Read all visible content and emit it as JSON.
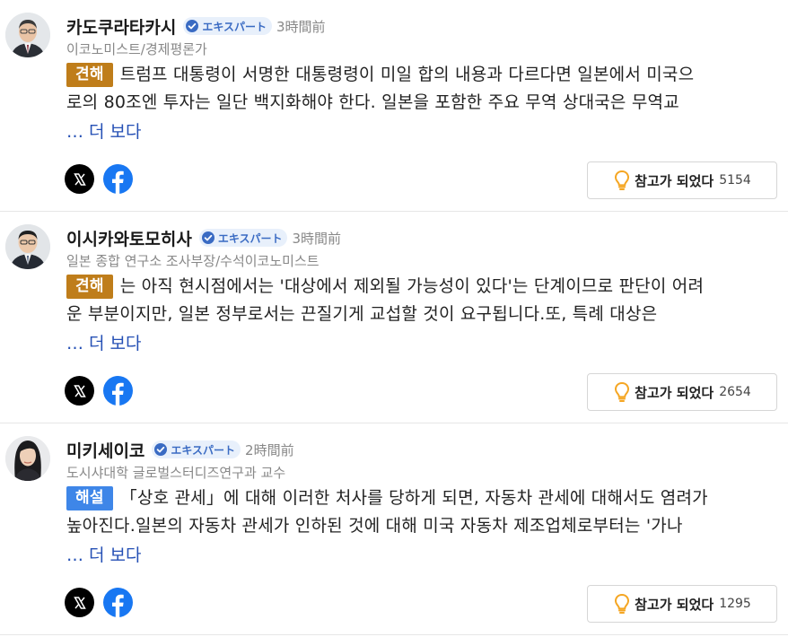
{
  "comments": [
    {
      "author": "카도쿠라타카시",
      "badge": "エキスパート",
      "time": "3時間前",
      "title": "이코노미스트/경제평론가",
      "label": "견해",
      "line1": "트럼프 대통령이 서명한 대통령령이 미일 합의 내용과 다르다면 일본에서 미국으",
      "line2": "로의 80조엔 투자는 일단 백지화해야 한다. 일본을 포함한 주요 무역 상대국은 무역교",
      "more": "… 더 보다",
      "helpful_label": "참고가 되었다",
      "helpful_count": "5154",
      "avatar": "man-in-suit-with-glasses"
    },
    {
      "author": "이시카와토모히사",
      "badge": "エキスパート",
      "time": "3時間前",
      "title": "일본 종합 연구소 조사부장/수석이코노미스트",
      "label": "견해",
      "line1": "는 아직 현시점에서는 '대상에서 제외될 가능성이 있다'는 단계이므로 판단이 어려",
      "line2": "운 부분이지만, 일본 정부로서는 끈질기게 교섭할 것이 요구됩니다.또, 특례 대상은",
      "more": "… 더 보다",
      "helpful_label": "참고가 되었다",
      "helpful_count": "2654",
      "avatar": "man-in-suit-with-glasses"
    },
    {
      "author": "미키세이코",
      "badge": "エキスパート",
      "time": "2時間前",
      "title": "도시샤대학 글로벌스터디즈연구과 교수",
      "label": "해설",
      "line1": "「상호 관세」에 대해 이러한 처사를 당하게 되면, 자동차 관세에 대해서도 염려가",
      "line2": "높아진다.일본의 자동차 관세가 인하된 것에 대해 미국 자동차 제조업체로부터는 '가나",
      "more": "… 더 보다",
      "helpful_label": "참고가 되었다",
      "helpful_count": "1295",
      "avatar": "woman-with-dark-hair"
    }
  ],
  "icons": {
    "badge": "verified-check-icon",
    "share_x": "x-logo-icon",
    "share_facebook": "facebook-logo-icon",
    "helpful": "lightbulb-icon"
  },
  "colors": {
    "opinion_label": "#bf7d1a",
    "explain_label": "#3e86e8",
    "badge_text": "#3a6bc3",
    "link": "#2550b5",
    "facebook": "#1877f2",
    "bulb": "#f5a623"
  }
}
